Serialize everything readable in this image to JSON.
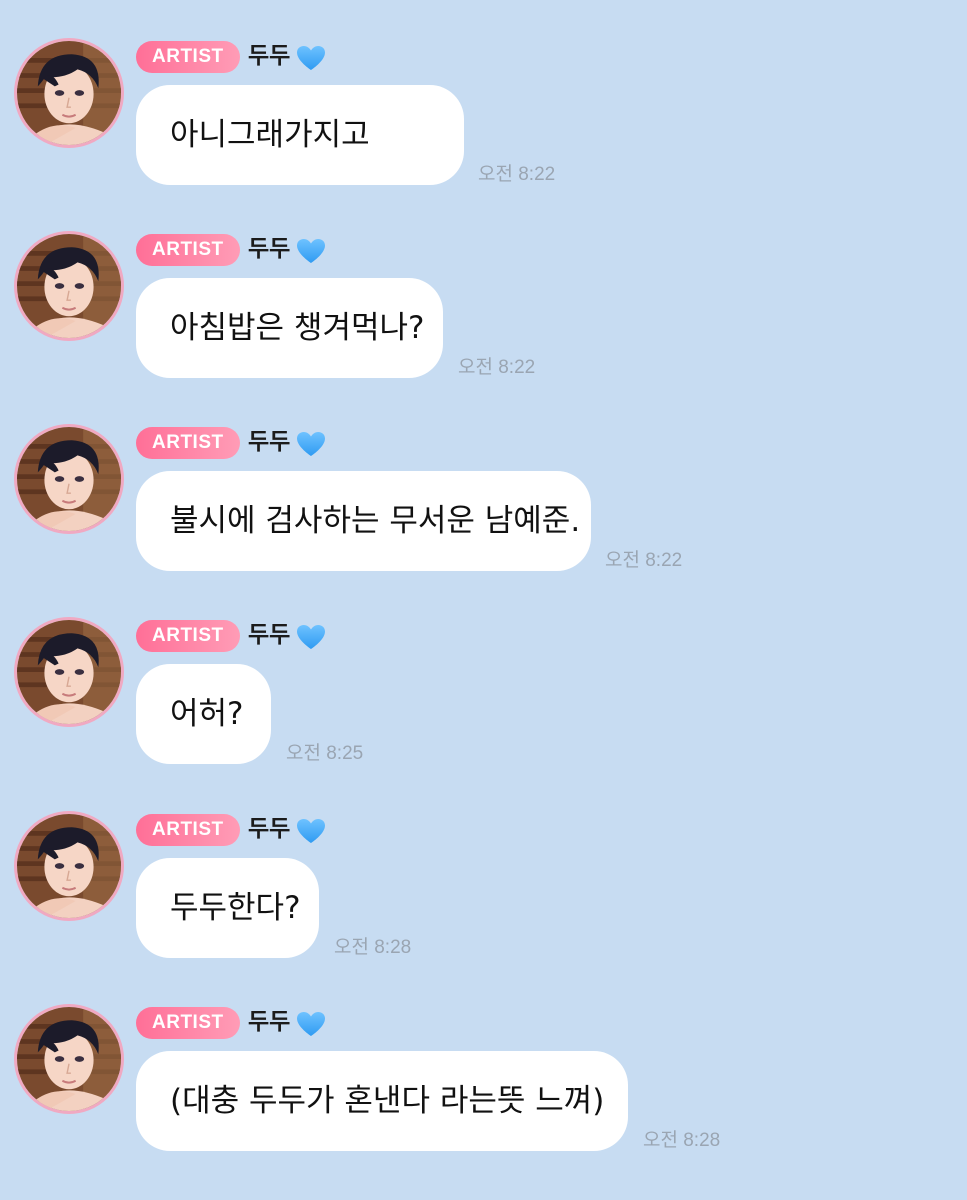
{
  "chat": {
    "messages": [
      {
        "badge": "ARTIST",
        "sender": "두두",
        "text": "아니그래가지고",
        "time": "오전 8:22"
      },
      {
        "badge": "ARTIST",
        "sender": "두두",
        "text": "아침밥은 챙겨먹나?",
        "time": "오전 8:22"
      },
      {
        "badge": "ARTIST",
        "sender": "두두",
        "text": "불시에 검사하는 무서운 남예준.",
        "time": "오전 8:22"
      },
      {
        "badge": "ARTIST",
        "sender": "두두",
        "text": "어허?",
        "time": "오전 8:25"
      },
      {
        "badge": "ARTIST",
        "sender": "두두",
        "text": "두두한다?",
        "time": "오전 8:28"
      },
      {
        "badge": "ARTIST",
        "sender": "두두",
        "text": "(대충 두두가 혼낸다 라는뜻 느껴)",
        "time": "오전 8:28"
      }
    ],
    "heart_icon": "blue-heart-icon",
    "colors": {
      "background": "#c7dcf2",
      "bubble": "#ffffff",
      "badge": "#ff7fa0",
      "heart": "#2f9bf2",
      "timestamp": "#9aa5b2",
      "avatar_ring": "#f0a9c2"
    }
  }
}
